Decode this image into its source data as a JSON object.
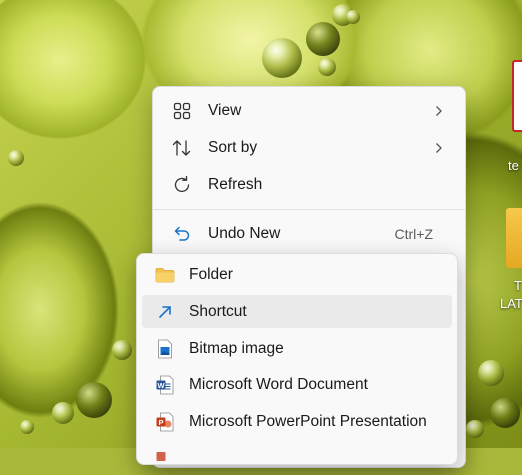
{
  "desktop": {
    "item_right_top_label": "te",
    "item_right_folder_label_1": "T",
    "item_right_folder_label_2": "LAT"
  },
  "context_menu": {
    "items": [
      {
        "label": "View",
        "icon": "view-grid-icon",
        "has_submenu": true
      },
      {
        "label": "Sort by",
        "icon": "sort-icon",
        "has_submenu": true
      },
      {
        "label": "Refresh",
        "icon": "refresh-icon",
        "has_submenu": false
      },
      {
        "label": "Undo New",
        "icon": "undo-icon",
        "shortcut": "Ctrl+Z"
      }
    ]
  },
  "new_submenu": {
    "items": [
      {
        "label": "Folder",
        "icon": "folder-icon"
      },
      {
        "label": "Shortcut",
        "icon": "shortcut-arrow-icon",
        "highlighted": true
      },
      {
        "label": "Bitmap image",
        "icon": "bitmap-image-icon"
      },
      {
        "label": "Microsoft Word Document",
        "icon": "word-document-icon"
      },
      {
        "label": "Microsoft PowerPoint Presentation",
        "icon": "powerpoint-presentation-icon"
      }
    ]
  },
  "colors": {
    "accent_blue": "#1a73c8",
    "folder_yellow": "#f2c14e",
    "word_blue": "#2b579a",
    "powerpoint_red": "#c43e1c",
    "hover_bg": "#eaeaea"
  }
}
